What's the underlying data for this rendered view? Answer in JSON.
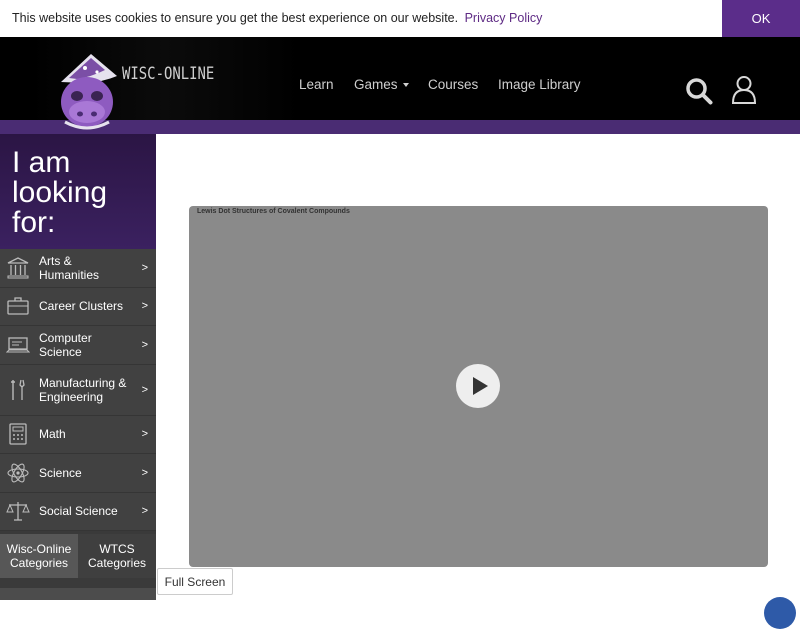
{
  "cookie_bar": {
    "message": "This website uses cookies to ensure you get the best experience on our website.",
    "link_label": "Privacy Policy",
    "ok_label": "OK"
  },
  "header": {
    "logo_text": "WISC-ONLINE",
    "nav": [
      {
        "label": "Learn"
      },
      {
        "label": "Games",
        "has_dropdown": true
      },
      {
        "label": "Courses"
      },
      {
        "label": "Image Library"
      }
    ],
    "icons": [
      "search-icon",
      "user-icon"
    ]
  },
  "sidebar": {
    "heading": "I am looking for:",
    "categories": [
      {
        "label": "Arts & Humanities",
        "icon": "pillars-icon",
        "arrow": ">"
      },
      {
        "label": "Career Clusters",
        "icon": "briefcase-icon",
        "arrow": ">"
      },
      {
        "label": "Computer Science",
        "icon": "laptop-icon",
        "arrow": ">"
      },
      {
        "label": "Manufacturing & Engineering",
        "icon": "tools-icon",
        "arrow": ">"
      },
      {
        "label": "Math",
        "icon": "calculator-icon",
        "arrow": ">"
      },
      {
        "label": "Science",
        "icon": "atom-icon",
        "arrow": ">"
      },
      {
        "label": "Social Science",
        "icon": "scales-icon",
        "arrow": ">"
      }
    ],
    "tabs": [
      {
        "label": "Wisc-Online Categories"
      },
      {
        "label": "WTCS Categories"
      }
    ]
  },
  "video": {
    "title": "Lewis Dot Structures of Covalent Compounds"
  },
  "fullscreen_label": "Full Screen",
  "colors": {
    "brand_purple": "#5b2d8a",
    "header_black": "#000000",
    "sidebar_gray": "#414141"
  }
}
